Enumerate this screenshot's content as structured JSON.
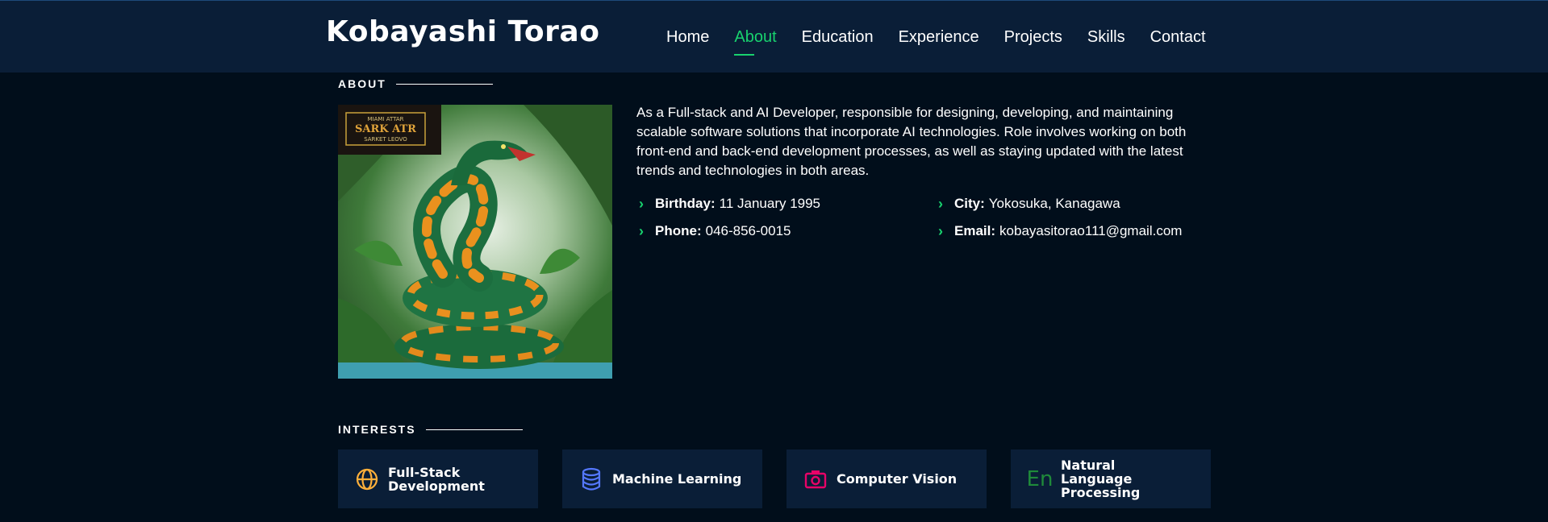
{
  "header": {
    "brand": "Kobayashi Torao",
    "nav": [
      {
        "label": "Home",
        "active": false
      },
      {
        "label": "About",
        "active": true
      },
      {
        "label": "Education",
        "active": false
      },
      {
        "label": "Experience",
        "active": false
      },
      {
        "label": "Projects",
        "active": false
      },
      {
        "label": "Skills",
        "active": false
      },
      {
        "label": "Contact",
        "active": false
      }
    ]
  },
  "about": {
    "section_title": "ABOUT",
    "description": "As a Full-stack and AI Developer, responsible for designing, developing, and maintaining scalable software solutions that incorporate AI technologies. Role involves working on both front-end and back-end development processes, as well as staying updated with the latest trends and technologies in both areas.",
    "facts": [
      {
        "label": "Birthday:",
        "value": "11 January 1995"
      },
      {
        "label": "City:",
        "value": "Yokosuka, Kanagawa"
      },
      {
        "label": "Phone:",
        "value": "046-856-0015"
      },
      {
        "label": "Email:",
        "value": "kobayasitorao111@gmail.com"
      }
    ],
    "photo_badge": {
      "line1": "MIAMI ATTAR",
      "line2": "SARK ATR",
      "line3": "SARKET LEOVO"
    }
  },
  "interests": {
    "section_title": "INTERESTS",
    "items": [
      {
        "label": "Full-Stack Development",
        "icon": "globe-icon",
        "color": "#ffb03b"
      },
      {
        "label": "Machine Learning",
        "icon": "database-icon",
        "color": "#5578ff"
      },
      {
        "label": "Computer Vision",
        "icon": "camera-icon",
        "color": "#e80368"
      },
      {
        "label": "Natural Language Processing",
        "icon": "language-icon",
        "color": "#11dbcf",
        "glyph": "En"
      }
    ]
  },
  "colors": {
    "accent": "#18d26e",
    "header_bg": "#0a1e37",
    "page_bg": "#010e1b"
  }
}
